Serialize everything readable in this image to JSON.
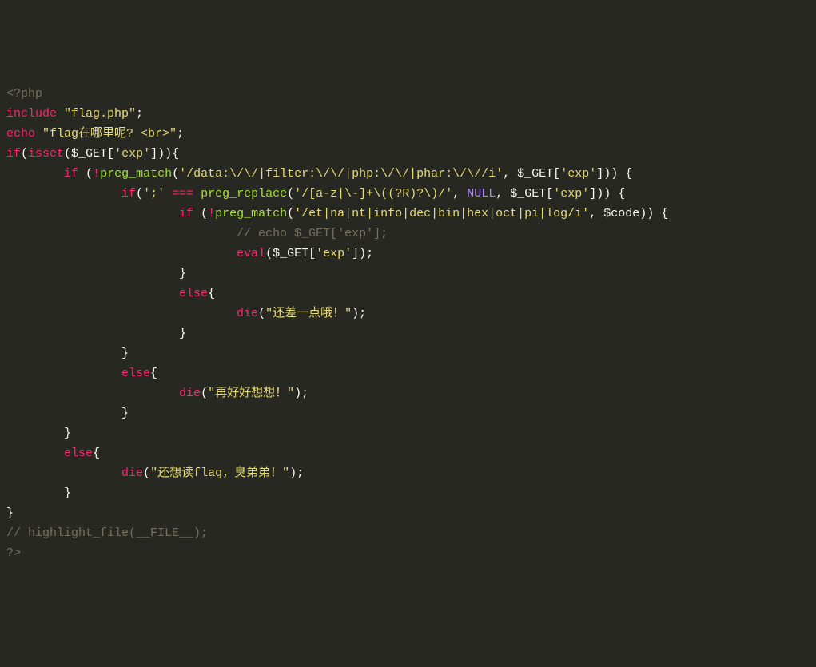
{
  "code": {
    "lines": [
      [
        {
          "cls": "tok-dim",
          "t": "<?php"
        }
      ],
      [
        {
          "cls": "tok-key",
          "t": "include"
        },
        {
          "cls": "tok-def",
          "t": " "
        },
        {
          "cls": "tok-str",
          "t": "\"flag.php\""
        },
        {
          "cls": "tok-def",
          "t": ";"
        }
      ],
      [
        {
          "cls": "tok-key",
          "t": "echo"
        },
        {
          "cls": "tok-def",
          "t": " "
        },
        {
          "cls": "tok-str",
          "t": "\"flag在哪里呢? <br>\""
        },
        {
          "cls": "tok-def",
          "t": ";"
        }
      ],
      [
        {
          "cls": "tok-key",
          "t": "if"
        },
        {
          "cls": "tok-def",
          "t": "("
        },
        {
          "cls": "tok-key",
          "t": "isset"
        },
        {
          "cls": "tok-def",
          "t": "($_GET["
        },
        {
          "cls": "tok-str",
          "t": "'exp'"
        },
        {
          "cls": "tok-def",
          "t": "])){"
        }
      ],
      [
        {
          "cls": "tok-def",
          "t": "        "
        },
        {
          "cls": "tok-key",
          "t": "if"
        },
        {
          "cls": "tok-def",
          "t": " ("
        },
        {
          "cls": "tok-key",
          "t": "!"
        },
        {
          "cls": "tok-func",
          "t": "preg_match"
        },
        {
          "cls": "tok-def",
          "t": "("
        },
        {
          "cls": "tok-str",
          "t": "'/data:\\/\\/|filter:\\/\\/|php:\\/\\/|phar:\\/\\//i'"
        },
        {
          "cls": "tok-def",
          "t": ", $_GET["
        },
        {
          "cls": "tok-str",
          "t": "'exp'"
        },
        {
          "cls": "tok-def",
          "t": "])) {"
        }
      ],
      [
        {
          "cls": "tok-def",
          "t": "                "
        },
        {
          "cls": "tok-key",
          "t": "if"
        },
        {
          "cls": "tok-def",
          "t": "("
        },
        {
          "cls": "tok-str",
          "t": "';'"
        },
        {
          "cls": "tok-def",
          "t": " "
        },
        {
          "cls": "tok-key",
          "t": "==="
        },
        {
          "cls": "tok-def",
          "t": " "
        },
        {
          "cls": "tok-func",
          "t": "preg_replace"
        },
        {
          "cls": "tok-def",
          "t": "("
        },
        {
          "cls": "tok-str",
          "t": "'/[a-z|\\-]+\\((?R)?\\)/'"
        },
        {
          "cls": "tok-def",
          "t": ", "
        },
        {
          "cls": "tok-null",
          "t": "NULL"
        },
        {
          "cls": "tok-def",
          "t": ", $_GET["
        },
        {
          "cls": "tok-str",
          "t": "'exp'"
        },
        {
          "cls": "tok-def",
          "t": "])) {"
        }
      ],
      [
        {
          "cls": "tok-def",
          "t": "                        "
        },
        {
          "cls": "tok-key",
          "t": "if"
        },
        {
          "cls": "tok-def",
          "t": " ("
        },
        {
          "cls": "tok-key",
          "t": "!"
        },
        {
          "cls": "tok-func",
          "t": "preg_match"
        },
        {
          "cls": "tok-def",
          "t": "("
        },
        {
          "cls": "tok-str",
          "t": "'/et|na|nt|info|dec|bin|hex|oct|pi|log/i'"
        },
        {
          "cls": "tok-def",
          "t": ", $code)) {"
        }
      ],
      [
        {
          "cls": "tok-def",
          "t": "                                "
        },
        {
          "cls": "tok-dim",
          "t": "// echo $_GET['exp'];"
        }
      ],
      [
        {
          "cls": "tok-def",
          "t": "                                "
        },
        {
          "cls": "tok-key",
          "t": "eval"
        },
        {
          "cls": "tok-def",
          "t": "($_GET["
        },
        {
          "cls": "tok-str",
          "t": "'exp'"
        },
        {
          "cls": "tok-def",
          "t": "]);"
        }
      ],
      [
        {
          "cls": "tok-def",
          "t": "                        }"
        }
      ],
      [
        {
          "cls": "tok-def",
          "t": "                        "
        },
        {
          "cls": "tok-key",
          "t": "else"
        },
        {
          "cls": "tok-def",
          "t": "{"
        }
      ],
      [
        {
          "cls": "tok-def",
          "t": "                                "
        },
        {
          "cls": "tok-key",
          "t": "die"
        },
        {
          "cls": "tok-def",
          "t": "("
        },
        {
          "cls": "tok-str",
          "t": "\"还差一点哦！\""
        },
        {
          "cls": "tok-def",
          "t": ");"
        }
      ],
      [
        {
          "cls": "tok-def",
          "t": "                        }"
        }
      ],
      [
        {
          "cls": "tok-def",
          "t": "                }"
        }
      ],
      [
        {
          "cls": "tok-def",
          "t": "                "
        },
        {
          "cls": "tok-key",
          "t": "else"
        },
        {
          "cls": "tok-def",
          "t": "{"
        }
      ],
      [
        {
          "cls": "tok-def",
          "t": "                        "
        },
        {
          "cls": "tok-key",
          "t": "die"
        },
        {
          "cls": "tok-def",
          "t": "("
        },
        {
          "cls": "tok-str",
          "t": "\"再好好想想！\""
        },
        {
          "cls": "tok-def",
          "t": ");"
        }
      ],
      [
        {
          "cls": "tok-def",
          "t": "                }"
        }
      ],
      [
        {
          "cls": "tok-def",
          "t": "        }"
        }
      ],
      [
        {
          "cls": "tok-def",
          "t": "        "
        },
        {
          "cls": "tok-key",
          "t": "else"
        },
        {
          "cls": "tok-def",
          "t": "{"
        }
      ],
      [
        {
          "cls": "tok-def",
          "t": "                "
        },
        {
          "cls": "tok-key",
          "t": "die"
        },
        {
          "cls": "tok-def",
          "t": "("
        },
        {
          "cls": "tok-str",
          "t": "\"还想读flag，臭弟弟！\""
        },
        {
          "cls": "tok-def",
          "t": ");"
        }
      ],
      [
        {
          "cls": "tok-def",
          "t": "        }"
        }
      ],
      [
        {
          "cls": "tok-def",
          "t": "}"
        }
      ],
      [
        {
          "cls": "tok-dim",
          "t": "// highlight_file(__FILE__);"
        }
      ],
      [
        {
          "cls": "tok-dim",
          "t": "?>"
        }
      ]
    ]
  }
}
